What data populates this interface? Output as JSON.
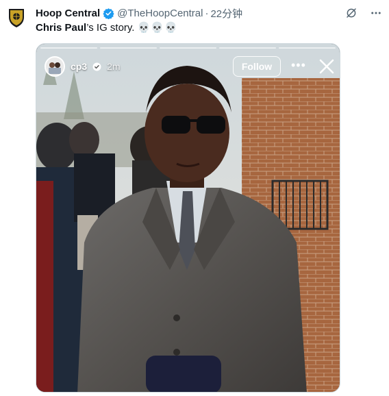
{
  "tweet": {
    "author_name": "Hoop Central",
    "handle": "@TheHoopCentral",
    "separator": "·",
    "time": "22分钟",
    "text_author": "Chris Paul",
    "text_rest": "’s IG story.",
    "skulls": "💀💀💀"
  },
  "story": {
    "username": "cp3",
    "time": "2m",
    "follow_label": "Follow",
    "more_label": "•••",
    "progress_segments": 5
  },
  "colors": {
    "text_primary": "#0f1419",
    "text_secondary": "#536471",
    "verified": "#1d9bf0",
    "avatar_gold": "#c9a227"
  },
  "icons": [
    "team-logo-avatar",
    "verified-badge-icon",
    "grok-icon",
    "more-icon",
    "close-icon",
    "story-avatar-icon"
  ]
}
